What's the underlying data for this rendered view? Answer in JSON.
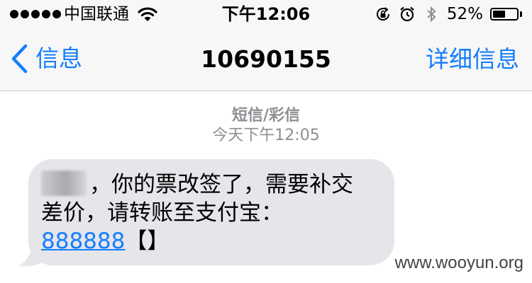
{
  "status_bar": {
    "carrier": "中国联通",
    "time": "下午12:06",
    "battery_percent": "52%",
    "battery_level": 0.52,
    "icons": [
      "signal-dots-icon",
      "wifi-icon",
      "rotation-lock-icon",
      "alarm-icon",
      "bluetooth-icon",
      "battery-icon"
    ]
  },
  "nav": {
    "back_label": "信息",
    "title": "10690155",
    "details_label": "详细信息"
  },
  "conversation": {
    "message_type": "短信/彩信",
    "timestamp": "今天下午12:05",
    "message": {
      "line1": "，你的票改签了，需要补交",
      "line2": "差价，请转账至支付宝：",
      "link": "888888",
      "link_suffix": "【】"
    }
  },
  "watermark": "www.wooyun.org",
  "colors": {
    "accent": "#157efb",
    "bubble": "#e5e5ea",
    "meta": "#8e8e93"
  }
}
